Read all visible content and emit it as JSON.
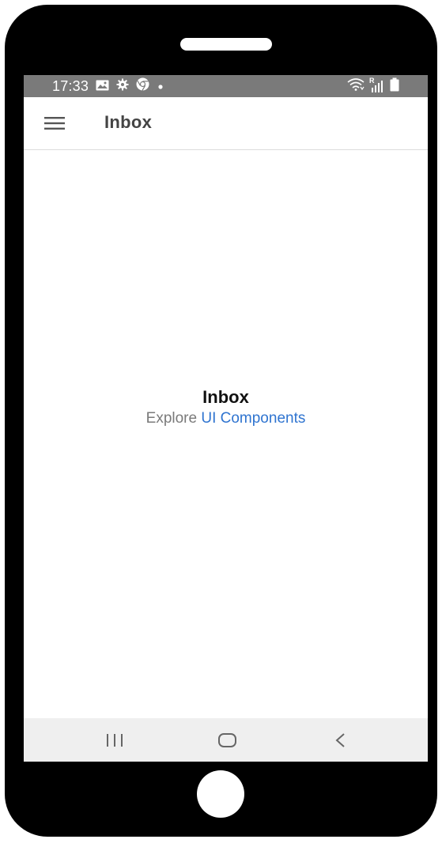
{
  "status_bar": {
    "time": "17:33",
    "left_icons": [
      "image-icon",
      "gear-icon",
      "chrome-icon",
      "dot-icon"
    ],
    "right_icons": [
      "wifi-icon",
      "signal-icon",
      "battery-icon"
    ],
    "signal_badge": "R"
  },
  "app_bar": {
    "menu_icon": "hamburger-menu-icon",
    "title": "Inbox"
  },
  "content": {
    "title": "Inbox",
    "subtitle_prefix": "Explore ",
    "subtitle_link": "UI Components"
  },
  "nav_bar": {
    "buttons": [
      "recents-icon",
      "home-icon",
      "back-icon"
    ]
  },
  "colors": {
    "status_bar": "#7a7a7a",
    "link": "#2f74d0",
    "nav_bar": "#efefef",
    "frame": "#000000"
  }
}
